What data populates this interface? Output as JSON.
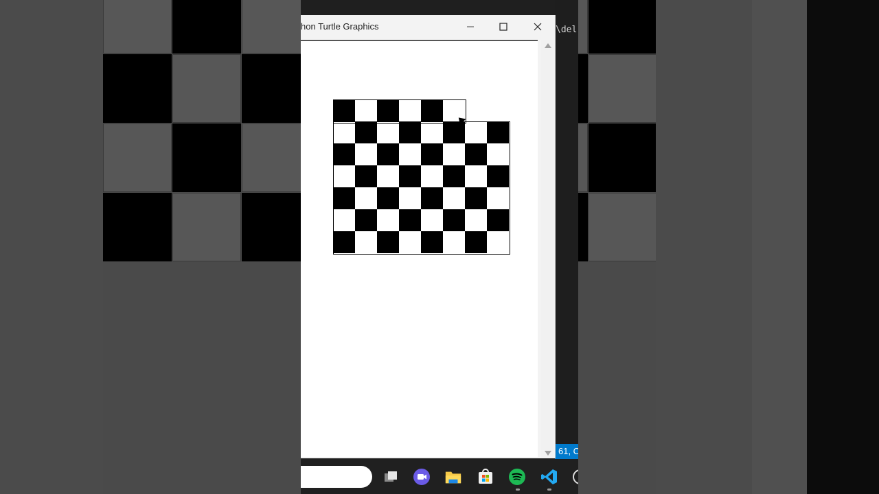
{
  "window": {
    "title": "hon Turtle Graphics",
    "minimize_label": "—"
  },
  "terminal": {
    "visible_text": "\\del"
  },
  "vscode_status": {
    "position": "61, C"
  },
  "board": {
    "cols": 8,
    "rows": 7,
    "top_row_squares": 6,
    "first_square": "black"
  },
  "taskbar": {
    "icons": [
      "task-view-icon",
      "meet-icon",
      "file-explorer-icon",
      "microsoft-store-icon",
      "spotify-icon",
      "vscode-icon",
      "clock-icon"
    ]
  },
  "colors": {
    "spotify": "#1db954",
    "vscode_blue": "#007acc",
    "folder": "#f7c948",
    "meet": "#6b5be6"
  }
}
